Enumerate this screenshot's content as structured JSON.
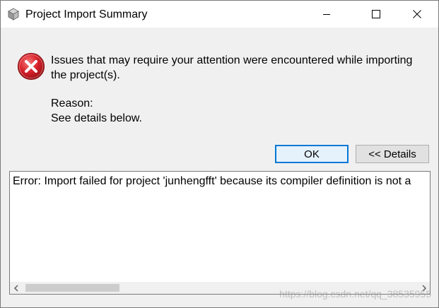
{
  "window": {
    "title": "Project Import Summary",
    "app_icon": "eclipse-cube-icon"
  },
  "titlebar_buttons": {
    "minimize_icon": "minimize-icon",
    "maximize_icon": "maximize-icon",
    "close_icon": "close-icon"
  },
  "message": {
    "icon": "error-icon",
    "text": "Issues that may require your attention were encountered while importing the project(s).",
    "reason_label": "Reason:",
    "reason_text": "See details below."
  },
  "buttons": {
    "ok_label": "OK",
    "details_label": "<< Details"
  },
  "details": {
    "text": "Error: Import failed for project 'junhengfft' because its compiler definition is not a"
  },
  "watermark": {
    "text": "https://blog.csdn.net/qq_38535955"
  },
  "colors": {
    "error_red": "#d9232c",
    "focus_blue": "#0078d7",
    "background": "#f0f0f0"
  }
}
